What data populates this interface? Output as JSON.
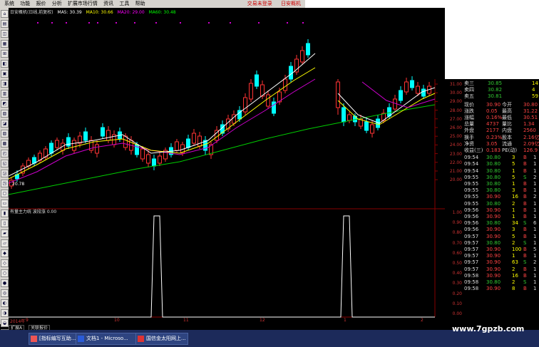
{
  "menu": {
    "items": [
      "系统",
      "功能",
      "报价",
      "分析",
      "扩展市场行情",
      "资讯",
      "工具",
      "帮助"
    ],
    "right_items": [
      "交易未登录",
      "日安概机"
    ]
  },
  "legend": {
    "title": "日安概机(日线,前复权)",
    "ma5": "MA5: 30.39",
    "ma10": "MA10: 30.66",
    "ma20": "MA20: 29.00",
    "ma60": "MA60: 30.48"
  },
  "sub_legend": "有量主力统 波段涨 0.00",
  "low_marker": "20.78",
  "price_axis": [
    "31.00",
    "30.00",
    "29.00",
    "28.00",
    "27.00",
    "26.00",
    "25.00",
    "24.00",
    "23.00",
    "22.00",
    "21.00",
    "20.00"
  ],
  "sub_axis": [
    "1.00",
    "0.90",
    "0.80",
    "0.70",
    "0.60",
    "0.50",
    "0.40",
    "0.30",
    "0.20",
    "0.10",
    "0.00"
  ],
  "x_axis": [
    "2014年",
    "9",
    "10",
    "11",
    "12",
    "1",
    "2"
  ],
  "tabs": [
    "扩展A",
    "关联报价"
  ],
  "quote": {
    "asks": [
      {
        "label": "卖三",
        "price": "30.85",
        "vol": "14"
      },
      {
        "label": "卖四",
        "price": "30.82",
        "vol": "4"
      },
      {
        "label": "卖五",
        "price": "30.81",
        "vol": "59"
      }
    ],
    "stats": [
      {
        "l1": "现价",
        "v1": "30.90",
        "l2": "今开",
        "v2": "30.80"
      },
      {
        "l1": "涨跌",
        "v1": "0.05",
        "l2": "最高",
        "v2": "31.22"
      },
      {
        "l1": "涨幅",
        "v1": "0.16%",
        "l2": "最低",
        "v2": "30.51"
      },
      {
        "l1": "总量",
        "v1": "4737",
        "l2": "量比",
        "v2": "1.34"
      },
      {
        "l1": "外盘",
        "v1": "2177",
        "l2": "内盘",
        "v2": "2560"
      },
      {
        "l1": "换手",
        "v1": "0.23%",
        "l2": "股本",
        "v2": "2.16亿"
      },
      {
        "l1": "净资",
        "v1": "3.05",
        "l2": "流通",
        "v2": "2.09亿"
      },
      {
        "l1": "收益(三)",
        "v1": "0.183",
        "l2": "PE(动)",
        "v2": "126.9"
      }
    ],
    "ticks": [
      {
        "t": "09:54",
        "p": "30.80",
        "v": "3",
        "s": "B",
        "n": "1"
      },
      {
        "t": "09:54",
        "p": "30.80",
        "v": "5",
        "s": "B",
        "n": "1"
      },
      {
        "t": "09:54",
        "p": "30.80",
        "v": "1",
        "s": "B",
        "n": "1"
      },
      {
        "t": "09:55",
        "p": "30.80",
        "v": "5",
        "s": "S",
        "n": "2"
      },
      {
        "t": "09:55",
        "p": "30.80",
        "v": "1",
        "s": "B",
        "n": "1"
      },
      {
        "t": "09:55",
        "p": "30.80",
        "v": "3",
        "s": "B",
        "n": "1"
      },
      {
        "t": "09:55",
        "p": "30.90",
        "v": "16",
        "s": "B",
        "n": "2"
      },
      {
        "t": "09:55",
        "p": "30.80",
        "v": "2",
        "s": "B",
        "n": "1"
      },
      {
        "t": "09:56",
        "p": "30.90",
        "v": "1",
        "s": "B",
        "n": "1"
      },
      {
        "t": "09:56",
        "p": "30.90",
        "v": "1",
        "s": "B",
        "n": "1"
      },
      {
        "t": "09:56",
        "p": "30.80",
        "v": "34",
        "s": "S",
        "n": "6"
      },
      {
        "t": "09:56",
        "p": "30.90",
        "v": "3",
        "s": "B",
        "n": "1"
      },
      {
        "t": "09:57",
        "p": "30.90",
        "v": "5",
        "s": "B",
        "n": "1"
      },
      {
        "t": "09:57",
        "p": "30.80",
        "v": "2",
        "s": "S",
        "n": "1"
      },
      {
        "t": "09:57",
        "p": "30.90",
        "v": "100",
        "s": "B",
        "n": "5"
      },
      {
        "t": "09:57",
        "p": "30.90",
        "v": "1",
        "s": "B",
        "n": "1"
      },
      {
        "t": "09:57",
        "p": "30.90",
        "v": "63",
        "s": "S",
        "n": "2"
      },
      {
        "t": "09:57",
        "p": "30.90",
        "v": "2",
        "s": "B",
        "n": "1"
      },
      {
        "t": "09:58",
        "p": "30.90",
        "v": "16",
        "s": "B",
        "n": "1"
      },
      {
        "t": "09:58",
        "p": "30.80",
        "v": "2",
        "s": "S",
        "n": "1"
      },
      {
        "t": "09:58",
        "p": "30.90",
        "v": "8",
        "s": "B",
        "n": "1"
      }
    ]
  },
  "taskbar": [
    {
      "label": "[指标编写互助..."
    },
    {
      "label": "文档1 - Microso..."
    },
    {
      "label": "国信金太阳网上..."
    }
  ],
  "watermark": "www.7gpzb.com"
}
